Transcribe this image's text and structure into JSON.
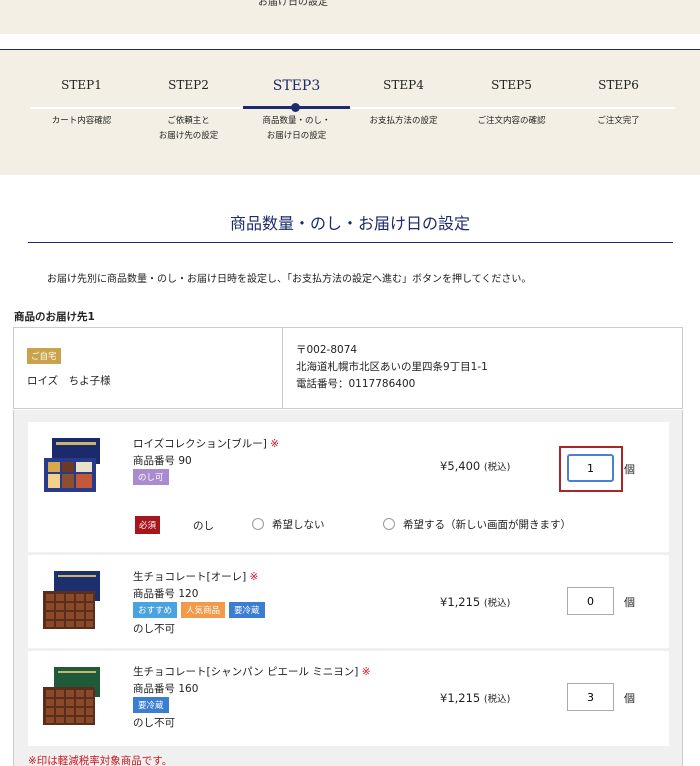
{
  "header": {
    "cut_text": "お届け日の設定"
  },
  "steps": [
    {
      "num": "STEP1",
      "label": "カート内容確認"
    },
    {
      "num": "STEP2",
      "label": "ご依頼主と\nお届け先の設定"
    },
    {
      "num": "STEP3",
      "label": "商品数量・のし・\nお届け日の設定"
    },
    {
      "num": "STEP4",
      "label": "お支払方法の設定"
    },
    {
      "num": "STEP5",
      "label": "ご注文内容の確認"
    },
    {
      "num": "STEP6",
      "label": "ご注文完了"
    }
  ],
  "active_step": "STEP3",
  "page": {
    "title": "商品数量・のし・お届け日の設定",
    "instructions": "お届け先別に商品数量・のし・お届け日時を設定し、「お支払方法の設定へ進む」ボタンを押してください。"
  },
  "destination": {
    "section_title": "商品のお届け先1",
    "badge": "ご自宅",
    "recipient": "ロイズ　ちよ子様",
    "postal": "〒002-8074",
    "address": "北海道札幌市北区あいの里四条9丁目1-1",
    "phone": "電話番号：0117786400"
  },
  "items": [
    {
      "name": "ロイズコレクション[ブルー]",
      "mark": "※",
      "code": "商品番号 90",
      "tags": [
        {
          "label": "のし可",
          "kind": "noshi"
        }
      ],
      "note": "",
      "price": "¥5,400",
      "tax": "(税込)",
      "qty": "1",
      "unit": "個"
    },
    {
      "name": "生チョコレート[オーレ]",
      "mark": "※",
      "code": "商品番号 120",
      "tags": [
        {
          "label": "おすすめ",
          "kind": "osusume"
        },
        {
          "label": "人気商品",
          "kind": "ninki"
        },
        {
          "label": "要冷蔵",
          "kind": "reizou"
        }
      ],
      "note": "のし不可",
      "price": "¥1,215",
      "tax": "(税込)",
      "qty": "0",
      "unit": "個"
    },
    {
      "name": "生チョコレート[シャンパン ピエール ミニヨン]",
      "mark": "※",
      "code": "商品番号 160",
      "tags": [
        {
          "label": "要冷蔵",
          "kind": "reizou"
        }
      ],
      "note": "のし不可",
      "price": "¥1,215",
      "tax": "(税込)",
      "qty": "3",
      "unit": "個"
    }
  ],
  "noshi": {
    "required": "必須",
    "label": "のし",
    "option_no": "希望しない",
    "option_yes": "希望する（新しい画面が開きます）"
  },
  "footnote": "※印は軽減税率対象商品です。",
  "colors": {
    "navy": "#1d2a6b",
    "beige": "#f3efe4",
    "accent_red": "#a8161d",
    "mark_red": "#c8161d",
    "home_badge": "#c9a24a"
  }
}
